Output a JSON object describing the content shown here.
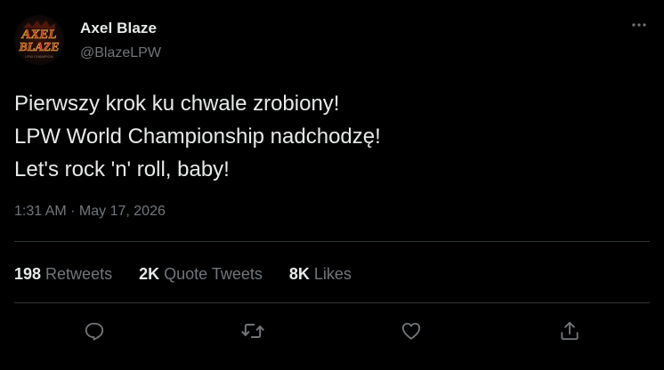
{
  "author": {
    "display_name": "Axel Blaze",
    "handle": "@BlazeLPW",
    "avatar_text_line1": "AXEL",
    "avatar_text_line2": "BLAZE",
    "avatar_text_line3": "LPW CHAMPION"
  },
  "tweet": {
    "lines": [
      "Pierwszy krok ku chwale zrobiony!",
      "LPW World Championship nadchodzę!",
      "Let's rock 'n' roll, baby!"
    ],
    "timestamp": "1:31 AM · May 17, 2026"
  },
  "stats": {
    "retweets_count": "198",
    "retweets_label": "Retweets",
    "quotes_count": "2K",
    "quotes_label": "Quote Tweets",
    "likes_count": "8K",
    "likes_label": "Likes"
  },
  "icons": {
    "more": "more-horizontal-icon",
    "reply": "reply-icon",
    "retweet": "retweet-icon",
    "like": "heart-icon",
    "share": "share-icon"
  },
  "colors": {
    "background": "#000000",
    "primary_text": "#e7e9ea",
    "secondary_text": "#71767b",
    "divider": "#2f3336",
    "logo_red": "#c0281e",
    "logo_gold": "#d9a441"
  }
}
